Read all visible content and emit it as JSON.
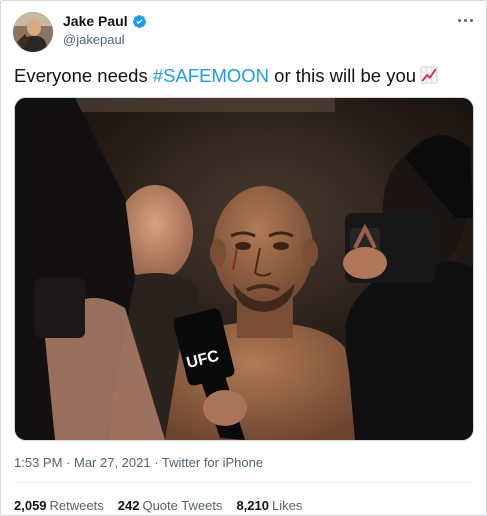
{
  "author": {
    "name": "Jake Paul",
    "handle": "@jakepaul",
    "verified": true,
    "verified_color": "#1d9bf0"
  },
  "tweet": {
    "text_before": "Everyone needs ",
    "hashtag": "#SAFEMOON",
    "text_after": " or this will be you",
    "emoji": "chart-increasing-icon"
  },
  "media": {
    "subject": "photo-fighter-being-interviewed",
    "mic_logo": "UFC"
  },
  "meta": {
    "time": "1:53 PM",
    "separator": " · ",
    "date": "Mar 27, 2021",
    "source": "Twitter for iPhone"
  },
  "stats": {
    "retweets_count": "2,059",
    "retweets_label": "Retweets",
    "quotes_count": "242",
    "quotes_label": "Quote Tweets",
    "likes_count": "8,210",
    "likes_label": "Likes"
  },
  "colors": {
    "accent": "#1d9bf0",
    "secondary_text": "#536471",
    "primary_text": "#0f1419",
    "border": "#cfd9de"
  }
}
